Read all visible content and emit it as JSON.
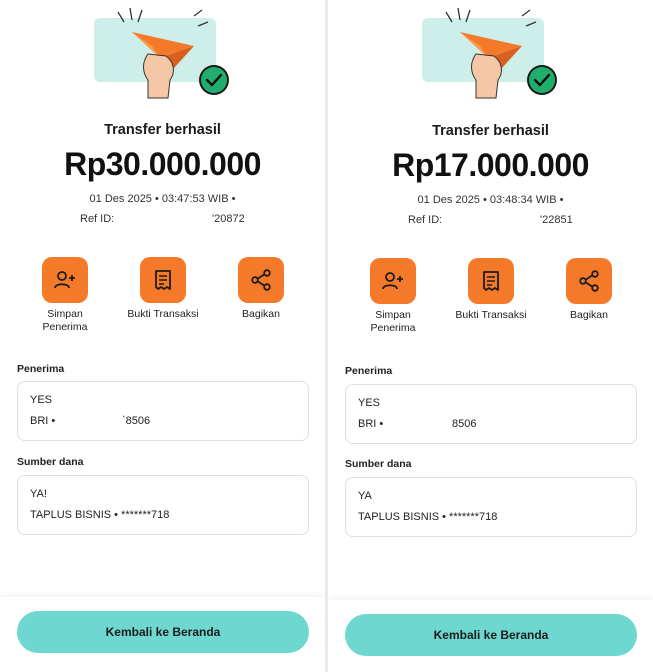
{
  "colors": {
    "accent_orange": "#f47a2a",
    "button_teal": "#6ed7cf",
    "check_green": "#1fae6e"
  },
  "screens": [
    {
      "title": "Transfer berhasil",
      "amount": "Rp30.000.000",
      "datetime": "01 Des 2025 • 03:47:53 WIB •",
      "ref_label": "Ref ID:",
      "ref_suffix": "'20872",
      "actions": [
        {
          "label": "Simpan Penerima",
          "icon": "add-person-icon"
        },
        {
          "label": "Bukti Transaksi",
          "icon": "receipt-icon"
        },
        {
          "label": "Bagikan",
          "icon": "share-icon"
        }
      ],
      "recipient": {
        "label": "Penerima",
        "name": "YES",
        "bank": "BRI •",
        "account_suffix": "`8506"
      },
      "source": {
        "label": "Sumber dana",
        "name": "YA!",
        "account": "TAPLUS BISNIS • *******718"
      },
      "home_button": "Kembali ke Beranda"
    },
    {
      "title": "Transfer berhasil",
      "amount": "Rp17.000.000",
      "datetime": "01 Des 2025 • 03:48:34 WIB •",
      "ref_label": "Ref ID:",
      "ref_suffix": "'22851",
      "actions": [
        {
          "label": "Simpan Penerima",
          "icon": "add-person-icon"
        },
        {
          "label": "Bukti Transaksi",
          "icon": "receipt-icon"
        },
        {
          "label": "Bagikan",
          "icon": "share-icon"
        }
      ],
      "recipient": {
        "label": "Penerima",
        "name": "YES",
        "bank": "BRI •",
        "account_suffix": "8506"
      },
      "source": {
        "label": "Sumber dana",
        "name": "YA",
        "account": "TAPLUS BISNIS • *******718"
      },
      "home_button": "Kembali ke Beranda"
    }
  ]
}
